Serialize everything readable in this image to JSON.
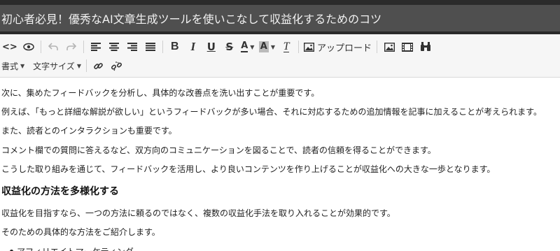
{
  "title": "初心者必見！優秀なAI文章生成ツールを使いこなして収益化するためのコツ",
  "toolbar": {
    "row1": [
      {
        "name": "source-code-icon",
        "glyph": "<>"
      },
      {
        "name": "preview-eye-icon",
        "glyph": "👁"
      },
      {
        "name": "undo-icon",
        "glyph": "↶"
      },
      {
        "name": "redo-icon",
        "glyph": "↷"
      },
      {
        "name": "align-left-icon",
        "glyph": "≡"
      },
      {
        "name": "align-center-icon",
        "glyph": "≡"
      },
      {
        "name": "align-right-icon",
        "glyph": "≡"
      },
      {
        "name": "align-justify-icon",
        "glyph": "≡"
      }
    ],
    "bold": "B",
    "italic": "I",
    "underline": "U",
    "strike": "S",
    "font_color": "A",
    "bg_color": "A",
    "clear_format": "T",
    "upload_label": "アップロード",
    "format_menu": "書式",
    "font_size_menu": "文字サイズ"
  },
  "content": {
    "paragraphs": [
      "次に、集めたフィードバックを分析し、具体的な改善点を洗い出すことが重要です。",
      "例えば、「もっと詳細な解説が欲しい」というフィードバックが多い場合、それに対応するための追加情報を記事に加えることが考えられます。",
      "また、読者とのインタラクションも重要です。",
      "コメント欄での質問に答えるなど、双方向のコミュニケーションを図ることで、読者の信頼を得ることができます。",
      "こうした取り組みを通じて、フィードバックを活用し、より良いコンテンツを作り上げることが収益化への大きな一歩となります。"
    ],
    "heading": "収益化の方法を多様化する",
    "paragraphs2": [
      "収益化を目指すなら、一つの方法に頼るのではなく、複数の収益化手法を取り入れることが効果的です。",
      "そのための具体的な方法をご紹介します。"
    ],
    "list": [
      "アフィリエイトマーケティング"
    ]
  }
}
